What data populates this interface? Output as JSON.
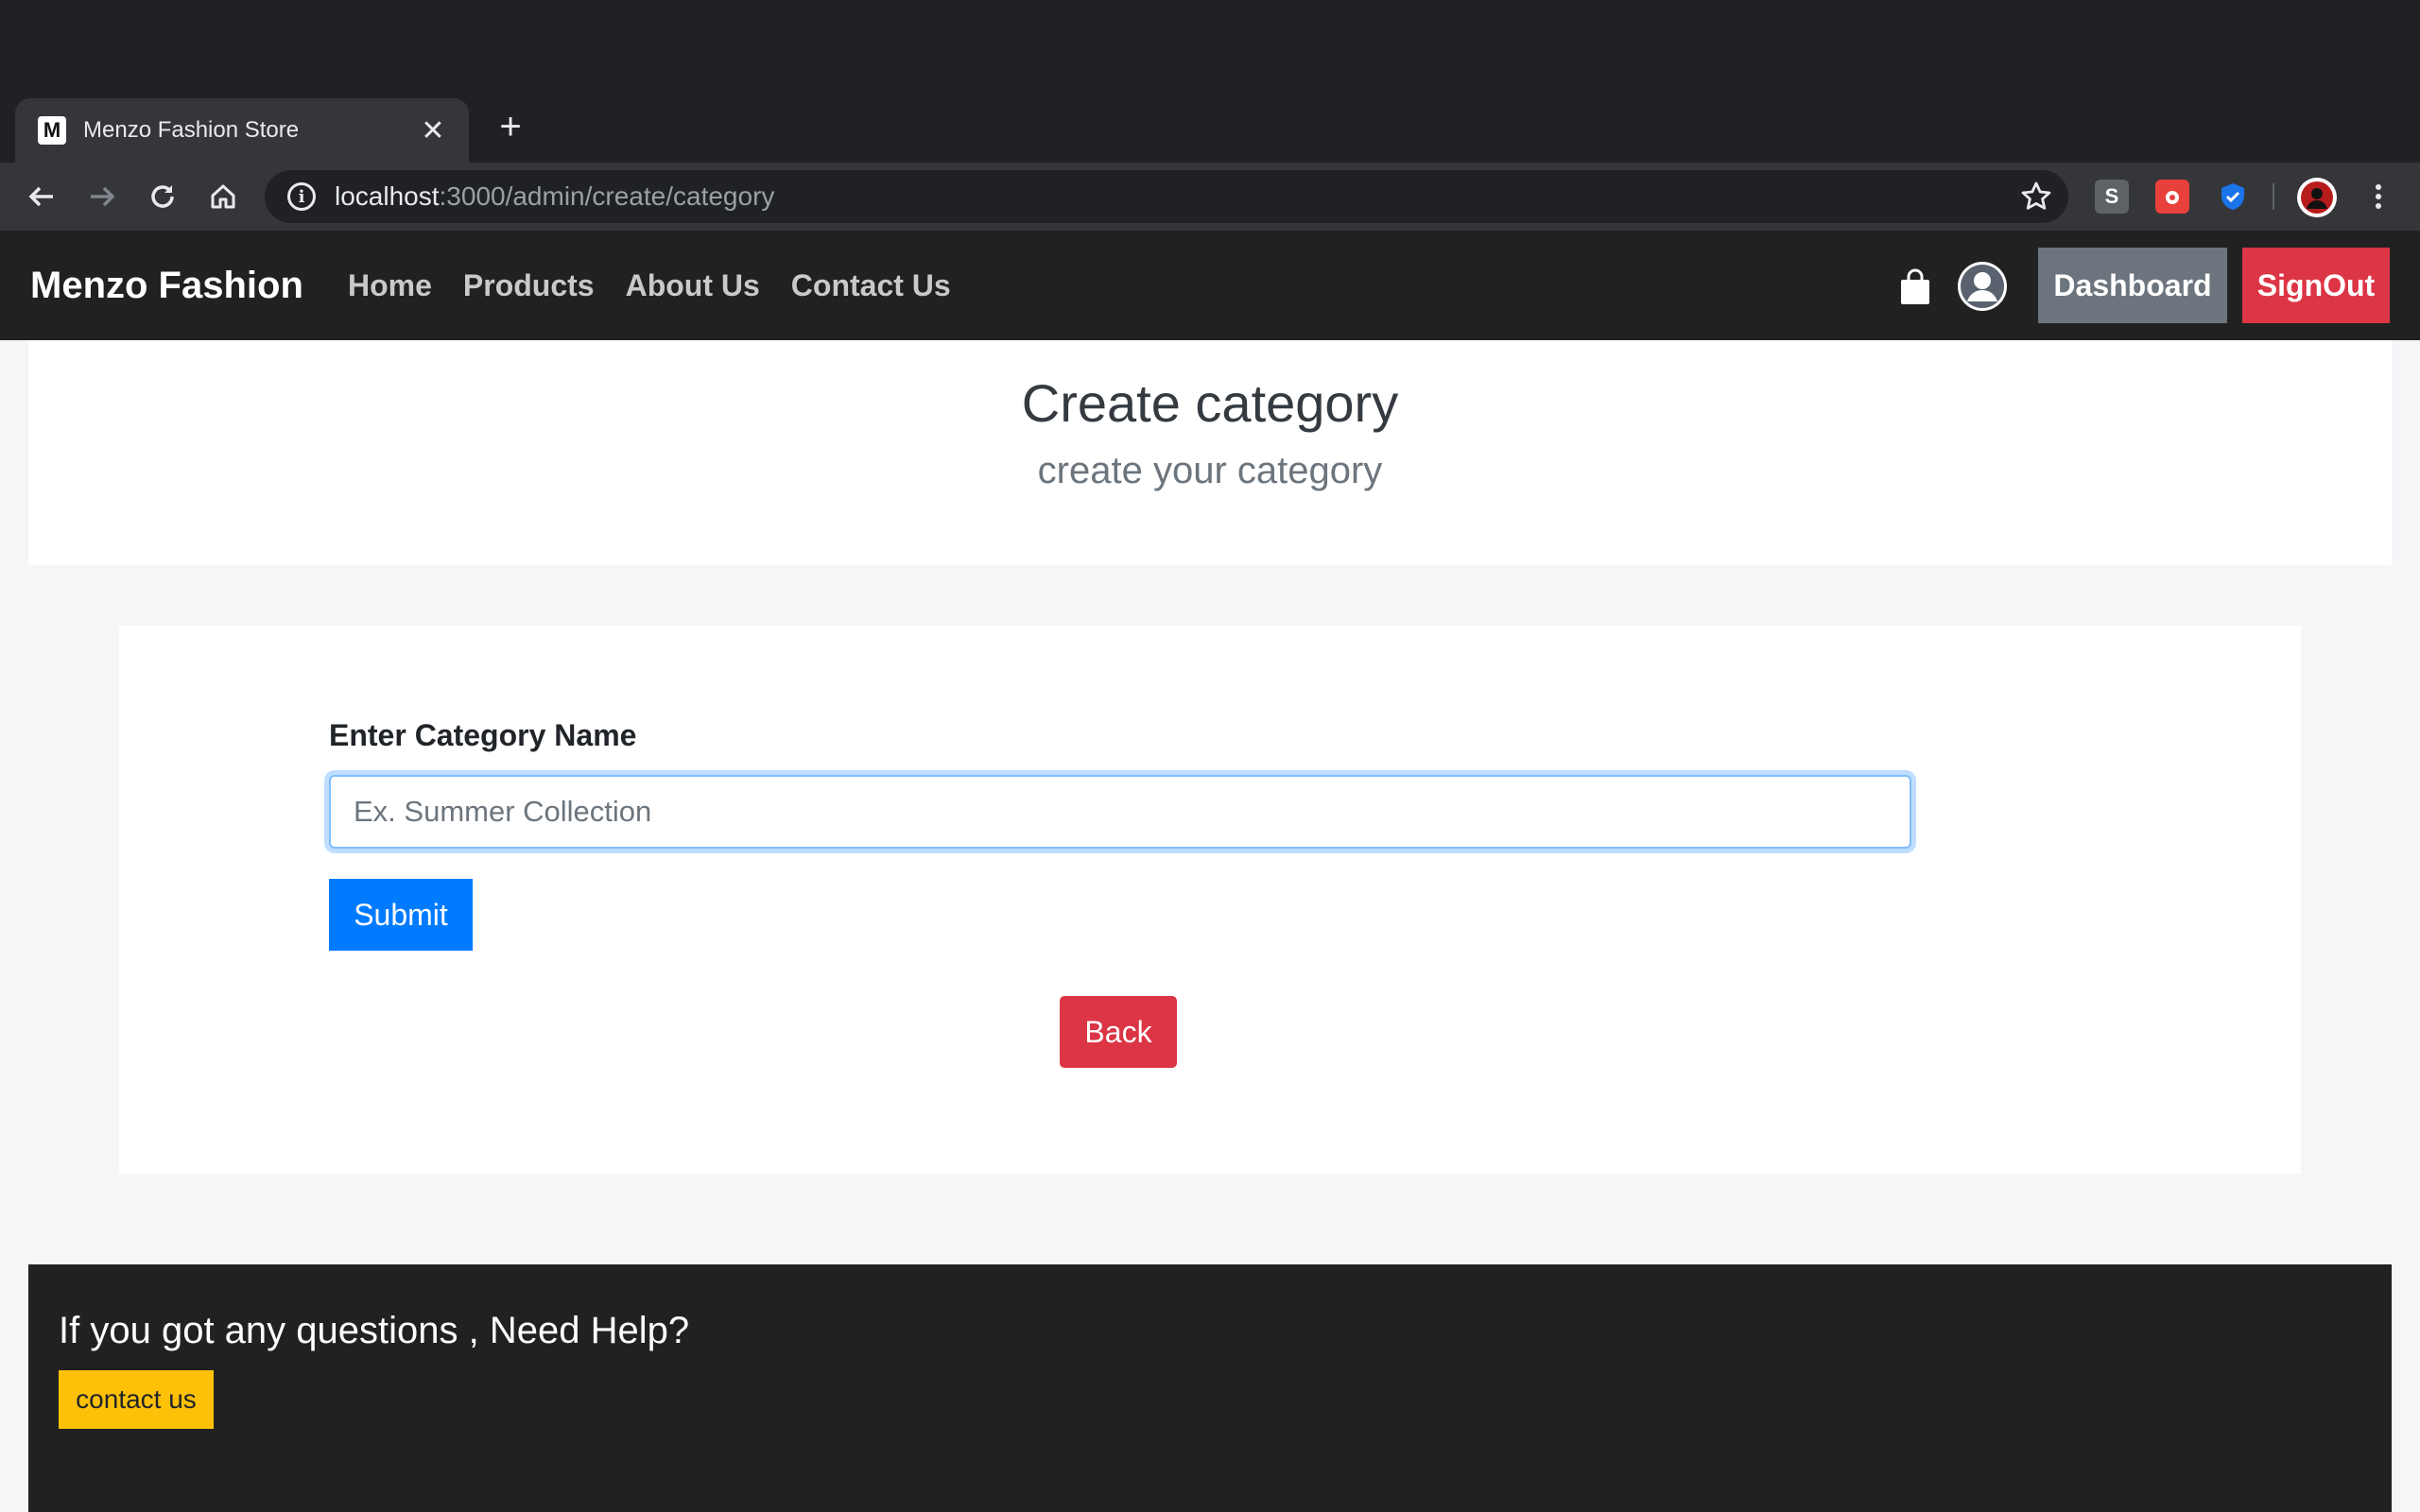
{
  "browser": {
    "tab_title": "Menzo Fashion Store",
    "tab_favicon": "M",
    "tab_close": "✕",
    "new_tab": "+",
    "url_host": "localhost",
    "url_path": ":3000/admin/create/category",
    "extensions": [
      {
        "name": "s-extension",
        "label": "S",
        "color": "#5f6368"
      },
      {
        "name": "red-extension",
        "label": "",
        "color": "#e8403a"
      },
      {
        "name": "shield-extension",
        "label": "",
        "color": "#1a73e8"
      }
    ]
  },
  "navbar": {
    "brand": "Menzo Fashion",
    "links": [
      "Home",
      "Products",
      "About Us",
      "Contact Us"
    ],
    "dashboard_label": "Dashboard",
    "signout_label": "SignOut"
  },
  "header": {
    "title": "Create category",
    "subtitle": "create your category"
  },
  "form": {
    "label": "Enter Category Name",
    "input_value": "",
    "input_placeholder": "Ex. Summer Collection",
    "submit_label": "Submit",
    "back_label": "Back"
  },
  "footer": {
    "question": "If you got any questions , Need Help?",
    "contact_label": "contact us"
  },
  "colors": {
    "navbar_bg": "#212121",
    "dashboard": "#6c757d",
    "signout": "#dc3545",
    "submit": "#007bff",
    "back": "#dc3545",
    "contact": "#ffc107"
  }
}
